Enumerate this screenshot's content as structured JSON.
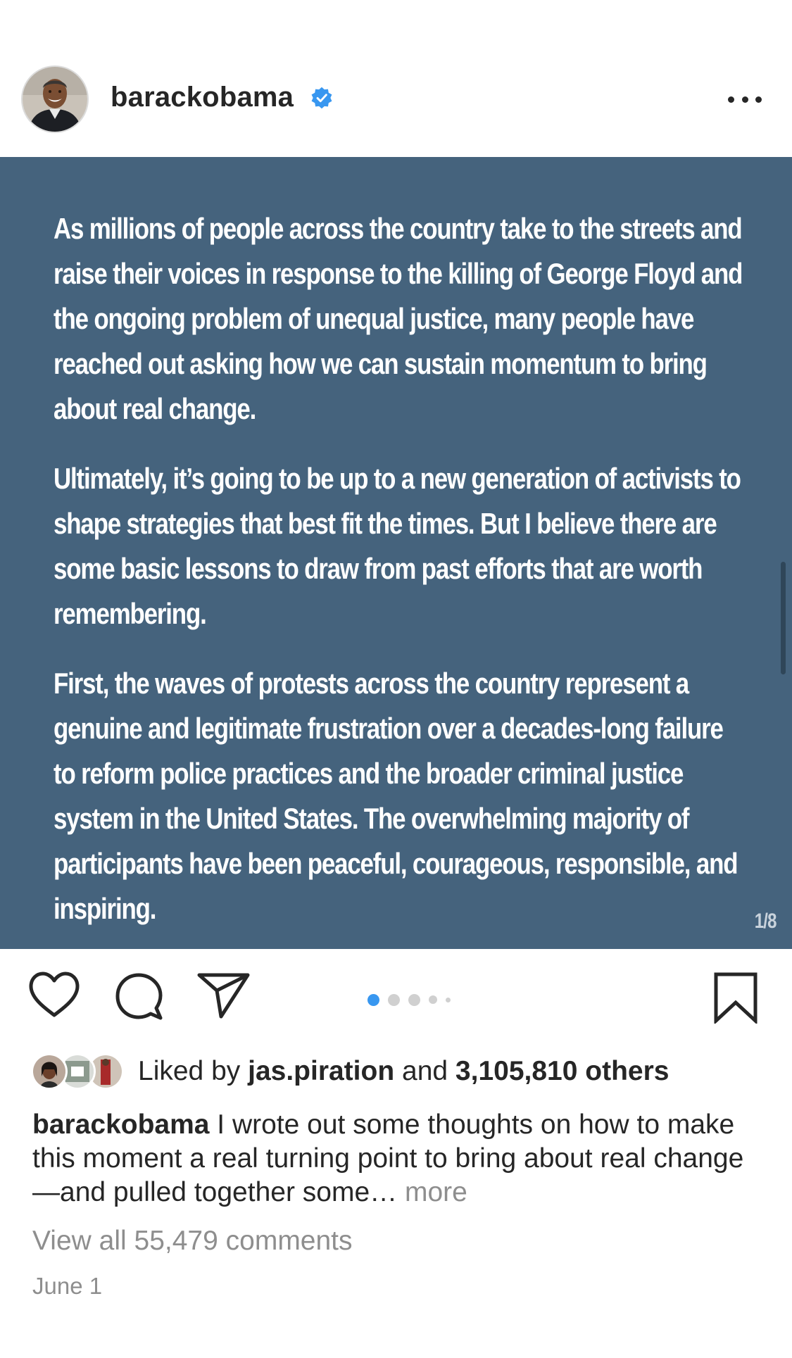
{
  "header": {
    "username": "barackobama",
    "verified": true,
    "avatar_icon": "profile-photo"
  },
  "post": {
    "paragraphs": [
      "As millions of people across the country take to the streets and raise their voices in response to the killing of George Floyd and the ongoing problem of unequal justice, many people have reached out asking how we can sustain momentum to bring about real change.",
      "Ultimately, it’s going to be up to a new generation of activists to shape strategies that best fit the times. But I believe there are some basic lessons to draw from past efforts that are worth remembering.",
      "First, the waves of protests across the country represent a genuine and legitimate frustration over a decades-long failure to reform police practices and the broader criminal justice system in the United States. The overwhelming majority of participants have been peaceful, courageous, responsible, and inspiring."
    ],
    "page_counter": "1/8",
    "background_color": "#45637d",
    "carousel": {
      "total": 8,
      "active_index": 0
    }
  },
  "actions": {
    "like_icon": "heart-icon",
    "comment_icon": "comment-icon",
    "share_icon": "paper-plane-icon",
    "save_icon": "bookmark-icon"
  },
  "likes": {
    "prefix": "Liked by",
    "liked_by_user": "jas.piration",
    "connector": "and",
    "others": "3,105,810 others"
  },
  "caption": {
    "username": "barackobama",
    "text": " I wrote out some thoughts on how to make this moment a real turning point to bring about real change—and pulled together some…",
    "more": "more"
  },
  "comments": {
    "view_all": "View all 55,479 comments"
  },
  "date": "June 1",
  "colors": {
    "accent": "#3897f0",
    "text": "#262626",
    "muted": "#8e8e8e"
  }
}
